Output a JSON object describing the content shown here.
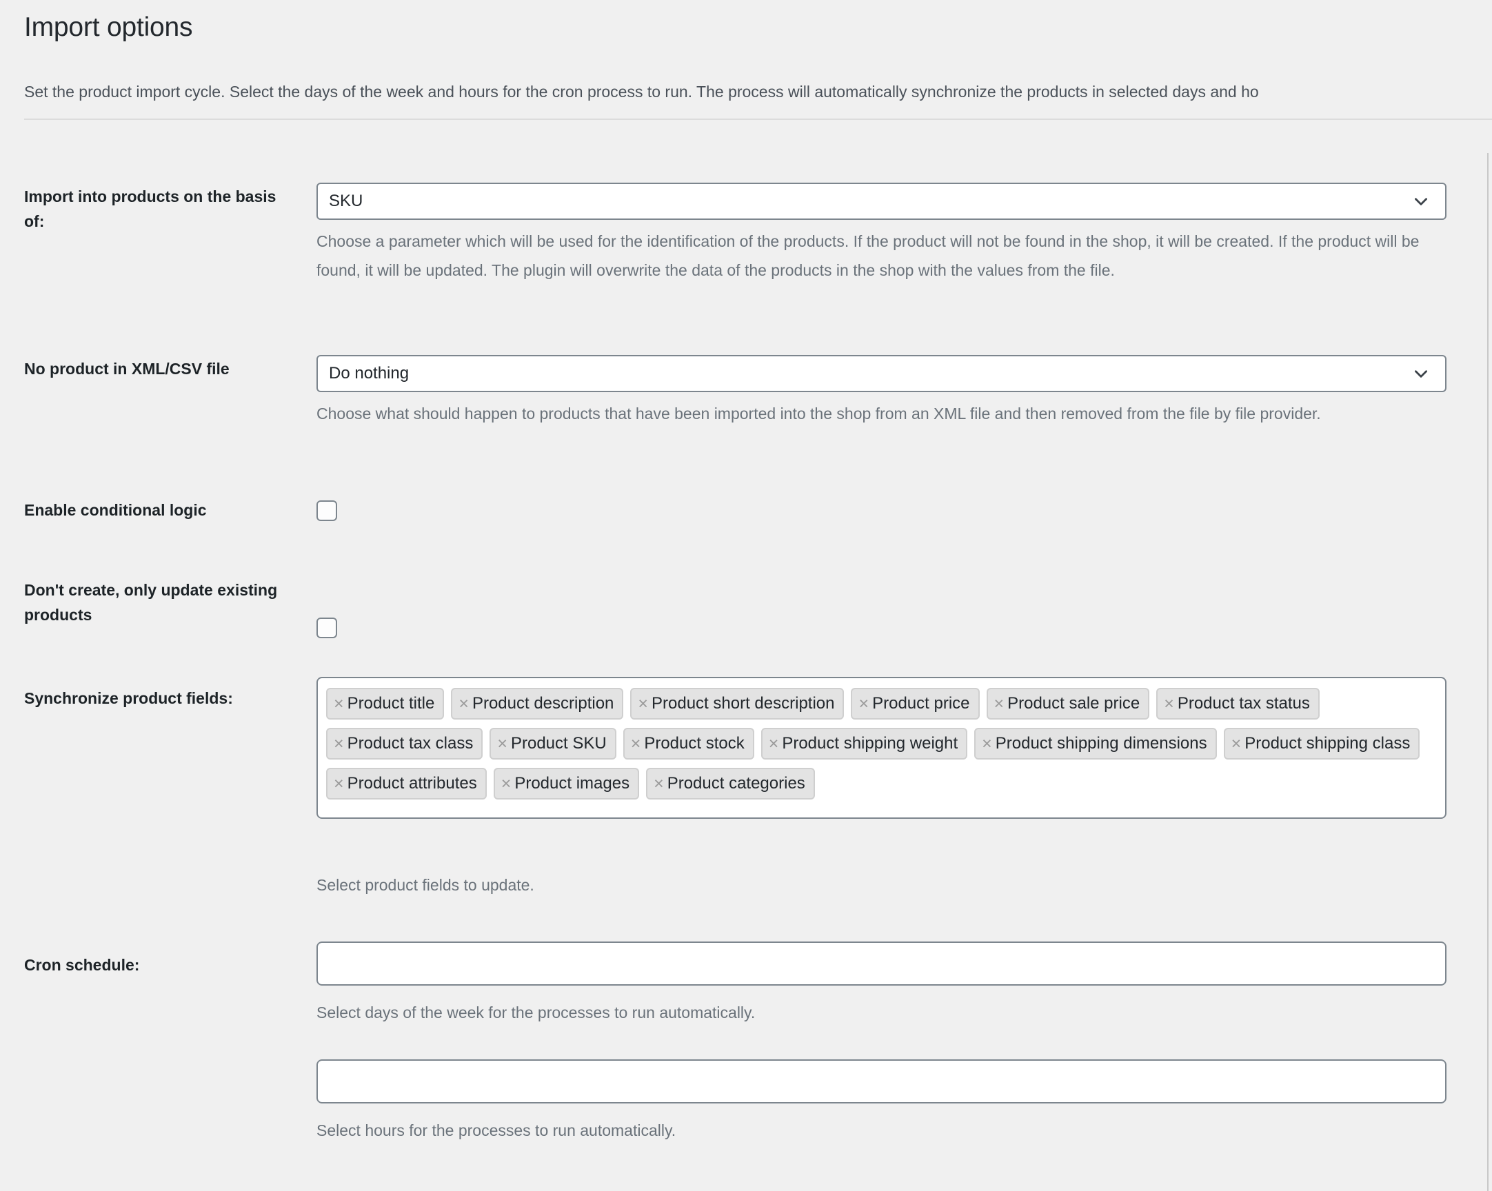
{
  "header": {
    "title": "Import options",
    "description": "Set the product import cycle. Select the days of the week and hours for the cron process to run. The process will automatically synchronize the products in selected days and ho"
  },
  "fields": {
    "import_basis": {
      "label": "Import into products on the basis of:",
      "value": "SKU",
      "help": "Choose a parameter which will be used for the identification of the products. If the product will not be found in the shop, it will be created. If the product will be found, it will be updated. The plugin will overwrite the data of the products in the shop with the values from the file."
    },
    "no_product": {
      "label": "No product in XML/CSV file",
      "value": "Do nothing",
      "help": "Choose what should happen to products that have been imported into the shop from an XML file and then removed from the file by file provider."
    },
    "conditional_logic": {
      "label": "Enable conditional logic",
      "checked": false
    },
    "only_update": {
      "label": "Don't create, only update existing products",
      "checked": false
    },
    "sync_fields": {
      "label": "Synchronize product fields:",
      "help": "Select product fields to update.",
      "remove_glyph": "×",
      "tags": [
        "Product title",
        "Product description",
        "Product short description",
        "Product price",
        "Product sale price",
        "Product tax status",
        "Product tax class",
        "Product SKU",
        "Product stock",
        "Product shipping weight",
        "Product shipping dimensions",
        "Product shipping class",
        "Product attributes",
        "Product images",
        "Product categories"
      ]
    },
    "cron_schedule": {
      "label": "Cron schedule:",
      "days_value": "",
      "days_placeholder": "",
      "days_help": "Select days of the week for the processes to run automatically.",
      "hours_value": "",
      "hours_placeholder": "",
      "hours_help": "Select hours for the processes to run automatically."
    }
  },
  "colors": {
    "page_background": "#f0f0f0",
    "field_border": "#7d868e",
    "tag_background": "#e3e3e3",
    "tag_border": "#cfcfcf",
    "help_text": "#6a727a",
    "label_text": "#1d2327",
    "divider": "#dcdcdc"
  }
}
